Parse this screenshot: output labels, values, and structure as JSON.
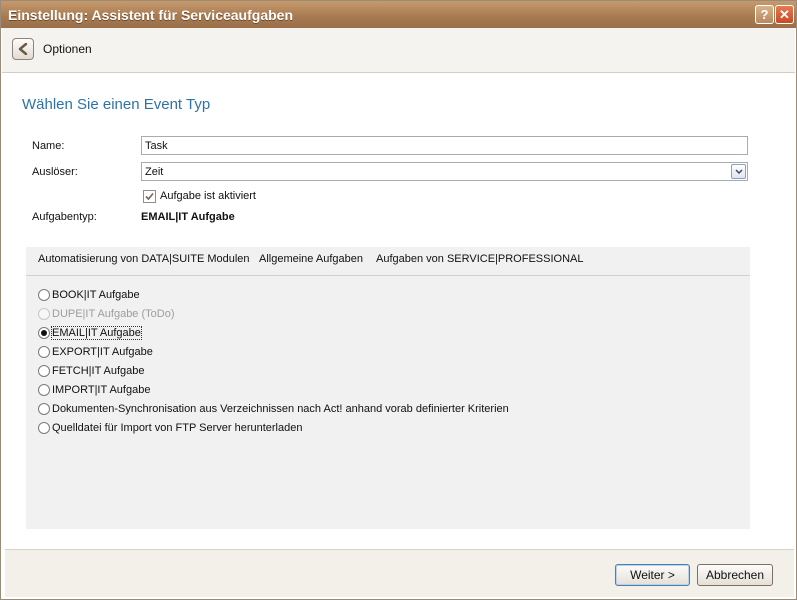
{
  "window": {
    "title": "Einstellung: Assistent für Serviceaufgaben",
    "help_label": "?",
    "close_label": "✕"
  },
  "nav": {
    "back_icon": "chevron-left-icon",
    "label": "Optionen"
  },
  "form": {
    "heading": "Wählen Sie einen Event Typ",
    "name_label": "Name:",
    "name_value": "Task",
    "trigger_label": "Auslöser:",
    "trigger_value": "Zeit",
    "active_checkbox_label": "Aufgabe ist aktiviert",
    "active_checked": true,
    "task_type_label": "Aufgabentyp:",
    "task_type_value": "EMAIL|IT Aufgabe"
  },
  "tabs": [
    {
      "label": "Automatisierung von DATA|SUITE Modulen",
      "selected": true
    },
    {
      "label": "Allgemeine Aufgaben",
      "selected": false
    },
    {
      "label": "Aufgaben von SERVICE|PROFESSIONAL",
      "selected": false
    }
  ],
  "options": [
    {
      "label": "BOOK|IT Aufgabe",
      "checked": false,
      "disabled": false
    },
    {
      "label": "DUPE|IT Aufgabe (ToDo)",
      "checked": false,
      "disabled": true
    },
    {
      "label": "EMAIL|IT Aufgabe",
      "checked": true,
      "disabled": false
    },
    {
      "label": "EXPORT|IT Aufgabe",
      "checked": false,
      "disabled": false
    },
    {
      "label": "FETCH|IT Aufgabe",
      "checked": false,
      "disabled": false
    },
    {
      "label": "IMPORT|IT Aufgabe",
      "checked": false,
      "disabled": false
    },
    {
      "label": "Dokumenten-Synchronisation aus Verzeichnissen nach Act! anhand vorab definierter Kriterien",
      "checked": false,
      "disabled": false
    },
    {
      "label": "Quelldatei für Import von FTP Server herunterladen",
      "checked": false,
      "disabled": false
    }
  ],
  "footer": {
    "next_label": "Weiter >",
    "cancel_label": "Abbrechen"
  },
  "colors": {
    "titlebar": "#a87b52",
    "heading": "#2e73a8",
    "tab_panel": "#f1f1f1"
  }
}
